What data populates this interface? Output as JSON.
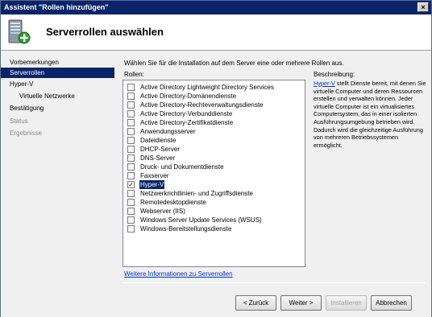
{
  "window": {
    "title": "Assistent \"Rollen hinzufügen\"",
    "close_glyph": "×"
  },
  "header": {
    "title": "Serverrollen auswählen",
    "icon": "server-add-icon"
  },
  "nav": {
    "items": [
      {
        "label": "Vorbemerkungen"
      },
      {
        "label": "Serverrollen"
      },
      {
        "label": "Hyper-V"
      },
      {
        "label": "Virtuelle Netzwerke"
      },
      {
        "label": "Bestätigung"
      },
      {
        "label": "Status"
      },
      {
        "label": "Ergebnisse"
      }
    ]
  },
  "main": {
    "instruction": "Wählen Sie für die Installation auf dem Server eine oder mehrere Rollen aus.",
    "roles_label": "Rollen:",
    "description_label": "Beschreibung:",
    "roles": [
      {
        "label": "Active Directory Lightweight Directory Services",
        "checked": false
      },
      {
        "label": "Active Directory-Domänendienste",
        "checked": false
      },
      {
        "label": "Active Directory-Rechteverwaltungsdienste",
        "checked": false
      },
      {
        "label": "Active Directory-Verbunddienste",
        "checked": false
      },
      {
        "label": "Active Directory-Zertifikatdienste",
        "checked": false
      },
      {
        "label": "Anwendungsserver",
        "checked": false
      },
      {
        "label": "Dateidienste",
        "checked": false
      },
      {
        "label": "DHCP-Server",
        "checked": false
      },
      {
        "label": "DNS-Server",
        "checked": false
      },
      {
        "label": "Druck- und Dokumentdienste",
        "checked": false
      },
      {
        "label": "Faxserver",
        "checked": false
      },
      {
        "label": "Hyper-V",
        "checked": true
      },
      {
        "label": "Netzwerkrichtlinien- und Zugriffsdienste",
        "checked": false
      },
      {
        "label": "Remotedesktopdienste",
        "checked": false
      },
      {
        "label": "Webserver (IIS)",
        "checked": false
      },
      {
        "label": "Windows Server Update Services (WSUS)",
        "checked": false
      },
      {
        "label": "Windows-Bereitstellungsdienste",
        "checked": false
      }
    ],
    "description_link": "Hyper-V",
    "description_text": " stellt Dienste bereit, mit denen Sie virtuelle Computer und deren Ressourcen erstellen und verwalten können. Jeder virtuelle Computer ist ein virtualisiertes Computersystem, das in einer isolierten Ausführungsumgebung betrieben wird. Dadurch wird die gleichzeitige Ausführung von mehreren Betriebssystemen ermöglicht.",
    "more_info_link": "Weitere Informationen zu Serverrollen"
  },
  "buttons": {
    "back": "< Zurück",
    "next": "Weiter >",
    "install": "Installieren",
    "cancel": "Abbrechen"
  },
  "colors": {
    "selection": "#0a246a",
    "link": "#0033cc"
  },
  "check_glyph": "✓"
}
